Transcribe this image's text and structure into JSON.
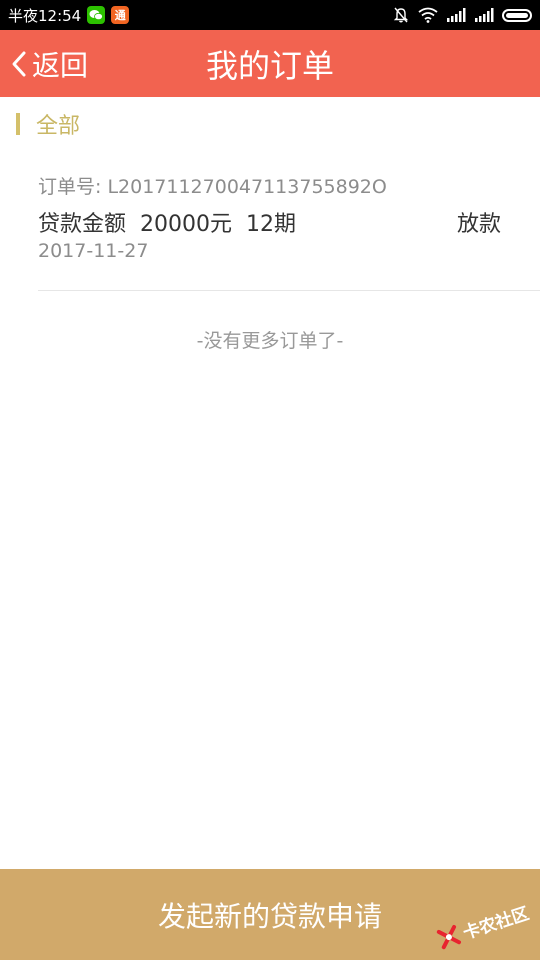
{
  "status_bar": {
    "time": "半夜12:54",
    "tong_icon_glyph": "通"
  },
  "header": {
    "back_label": "返回",
    "title": "我的订单"
  },
  "filter": {
    "label": "全部"
  },
  "orders": [
    {
      "number": "订单号: L201711270047113755892O",
      "amount_label": "贷款金额",
      "amount": "20000元",
      "term": "12期",
      "status": "放款",
      "date": "2017-11-27"
    }
  ],
  "no_more_text": "-没有更多订单了-",
  "footer": {
    "button_label": "发起新的贷款申请"
  },
  "watermark": {
    "text": "卡农社区"
  },
  "colors": {
    "header": "#f26350",
    "accent": "#c9b765",
    "footer": "#d1a96a"
  }
}
